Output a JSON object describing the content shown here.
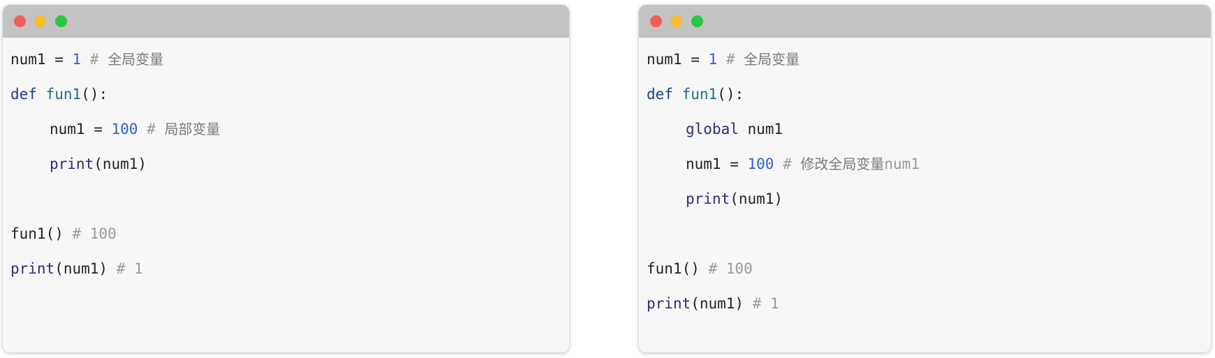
{
  "colors": {
    "titlebar": "#c3c3c3",
    "code_background": "#f7f7f7",
    "dot_red": "#ee5f58",
    "dot_yellow": "#f6bd2f",
    "dot_green": "#2bc641",
    "keyword": "#1f3f8a",
    "function": "#1b6e86",
    "builtin": "#2b2d7a",
    "number": "#2f5fd0",
    "comment": "#9a9a9a"
  },
  "left": {
    "l1": {
      "name": "num1",
      "op": " = ",
      "num": "1",
      "hash": " # ",
      "comment": "全局变量"
    },
    "l2": {
      "kw": "def",
      "fn": "fun1",
      "rest": "():"
    },
    "l3": {
      "name": "num1",
      "op": " = ",
      "num": "100",
      "hash": " # ",
      "comment": "局部变量"
    },
    "l4": {
      "builtin": "print",
      "args": "(num1)"
    },
    "l5": {
      "call": "fun1()",
      "comment": " # 100"
    },
    "l6": {
      "builtin": "print",
      "args": "(num1)",
      "comment": " # 1"
    }
  },
  "right": {
    "l1": {
      "name": "num1",
      "op": " = ",
      "num": "1",
      "hash": " # ",
      "comment": "全局变量"
    },
    "l2": {
      "kw": "def",
      "fn": "fun1",
      "rest": "():"
    },
    "l3": {
      "kw": "global",
      "name": " num1"
    },
    "l4": {
      "name": "num1",
      "op": " = ",
      "num": "100",
      "hash": " # ",
      "comment": "修改全局变量",
      "comment_tail": "num1"
    },
    "l5": {
      "builtin": "print",
      "args": "(num1)"
    },
    "l6": {
      "call": "fun1()",
      "comment": " # 100"
    },
    "l7": {
      "builtin": "print",
      "args": "(num1)",
      "comment": " # 1"
    }
  }
}
